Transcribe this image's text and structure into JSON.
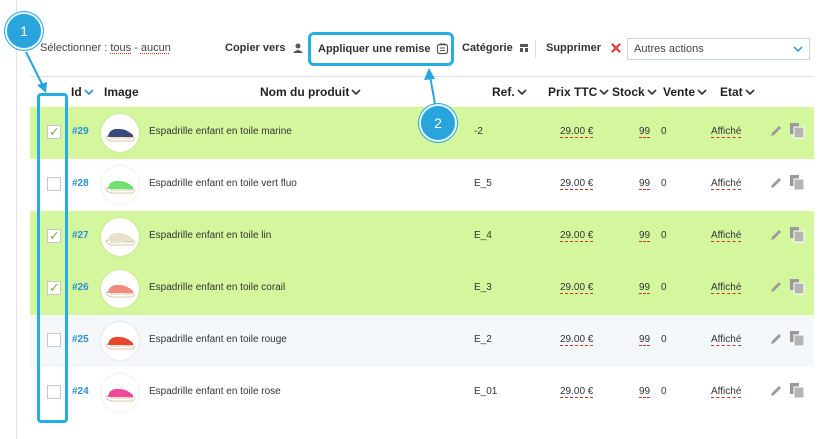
{
  "toolbar": {
    "select_label": "Sélectionner :",
    "select_all": "tous",
    "select_separator": "-",
    "select_none": "aucun",
    "copy_label": "Copier vers",
    "discount_label": "Appliquer une remise",
    "category_label": "Catégorie",
    "delete_label": "Supprimer",
    "other_actions_value": "Autres actions"
  },
  "columns": {
    "id": "Id",
    "image": "Image",
    "name": "Nom du produit",
    "ref": "Ref.",
    "price": "Prix TTC",
    "stock": "Stock",
    "sales": "Vente",
    "status": "Etat"
  },
  "rows": [
    {
      "checked": true,
      "id": "#29",
      "name": "Espadrille enfant en toile marine",
      "ref": "-2",
      "price": "29.00 €",
      "stock": "99",
      "sales": "0",
      "status": "Affiché",
      "shoe_color": "#3b4a7a"
    },
    {
      "checked": false,
      "id": "#28",
      "name": "Espadrille enfant en toile vert fluo",
      "ref": "E_5",
      "price": "29.00 €",
      "stock": "99",
      "sales": "0",
      "status": "Affiché",
      "shoe_color": "#6de070"
    },
    {
      "checked": true,
      "id": "#27",
      "name": "Espadrille enfant en toile lin",
      "ref": "E_4",
      "price": "29.00 €",
      "stock": "99",
      "sales": "0",
      "status": "Affiché",
      "shoe_color": "#e8e0cc"
    },
    {
      "checked": true,
      "id": "#26",
      "name": "Espadrille enfant en toile corail",
      "ref": "E_3",
      "price": "29.00 €",
      "stock": "99",
      "sales": "0",
      "status": "Affiché",
      "shoe_color": "#f28a80"
    },
    {
      "checked": false,
      "id": "#25",
      "name": "Espadrille enfant en toile rouge",
      "ref": "E_2",
      "price": "29.00 €",
      "stock": "99",
      "sales": "0",
      "status": "Affiché",
      "shoe_color": "#e8452f"
    },
    {
      "checked": false,
      "id": "#24",
      "name": "Espadrille enfant en toile rose",
      "ref": "E_01",
      "price": "29.00 €",
      "stock": "99",
      "sales": "0",
      "status": "Affiché",
      "shoe_color": "#f0479a"
    }
  ],
  "callouts": {
    "one": "1",
    "two": "2"
  },
  "colors": {
    "selected_row": "#d4f79e",
    "callout": "#29a4dc",
    "id_link": "#2b8fd6",
    "delete_red": "#e03c31"
  }
}
